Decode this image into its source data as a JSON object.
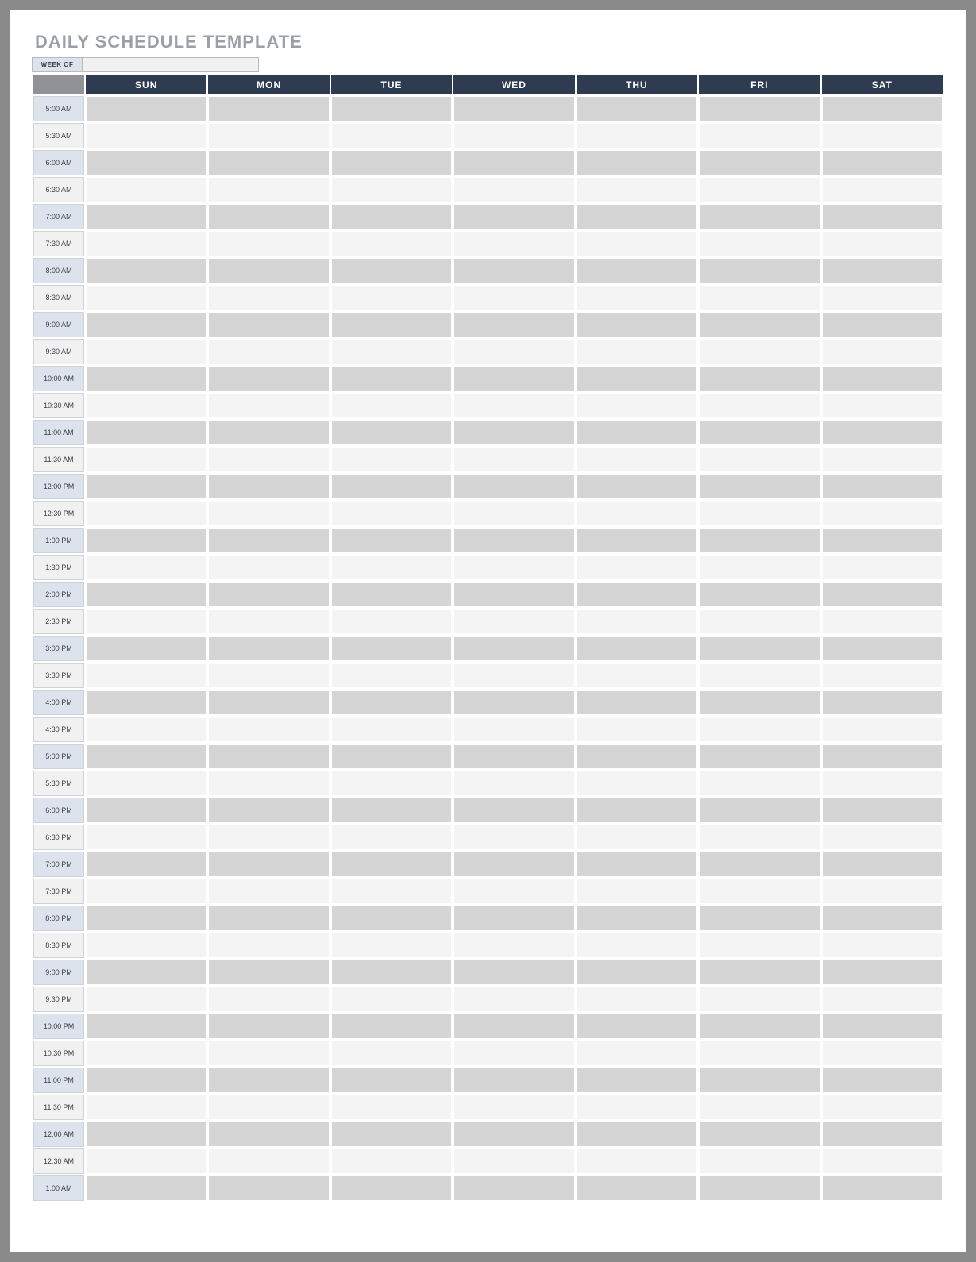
{
  "title": "DAILY SCHEDULE TEMPLATE",
  "week_of_label": "WEEK OF",
  "week_of_value": "",
  "days": [
    "SUN",
    "MON",
    "TUE",
    "WED",
    "THU",
    "FRI",
    "SAT"
  ],
  "times": [
    "5:00 AM",
    "5:30 AM",
    "6:00 AM",
    "6:30 AM",
    "7:00 AM",
    "7:30 AM",
    "8:00 AM",
    "8:30 AM",
    "9:00 AM",
    "9:30 AM",
    "10:00 AM",
    "10:30 AM",
    "11:00 AM",
    "11:30 AM",
    "12:00 PM",
    "12:30 PM",
    "1:00 PM",
    "1:30 PM",
    "2:00 PM",
    "2:30 PM",
    "3:00 PM",
    "3:30 PM",
    "4:00 PM",
    "4:30 PM",
    "5:00 PM",
    "5:30 PM",
    "6:00 PM",
    "6:30 PM",
    "7:00 PM",
    "7:30 PM",
    "8:00 PM",
    "8:30 PM",
    "9:00 PM",
    "9:30 PM",
    "10:00 PM",
    "10:30 PM",
    "11:00 PM",
    "11:30 PM",
    "12:00 AM",
    "12:30 AM",
    "1:00 AM"
  ],
  "cells": {}
}
